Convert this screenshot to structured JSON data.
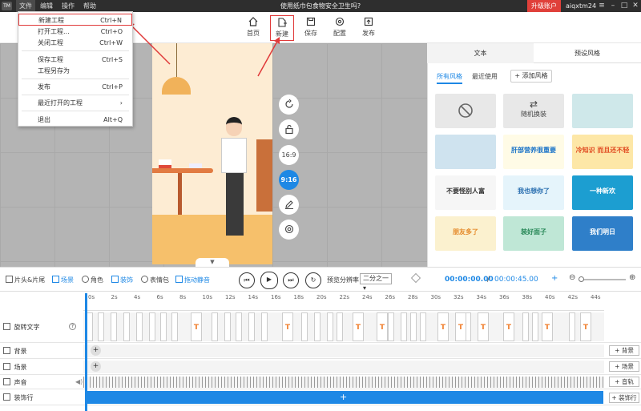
{
  "titlebar": {
    "logo": "TM",
    "menus": [
      "文件",
      "编辑",
      "操作",
      "帮助"
    ],
    "title": "使用纸巾包食物安全卫生吗?",
    "upgrade": "升级账户",
    "user": "aiqxtm24",
    "controls": {
      "menu": "≡",
      "minimize": "–",
      "maximize": "□",
      "close": "✕"
    }
  },
  "toolbar": {
    "home": "首页",
    "new": "新建",
    "save": "保存",
    "config": "配置",
    "publish": "发布"
  },
  "file_menu": {
    "items": [
      {
        "label": "新建工程",
        "shortcut": "Ctrl+N"
      },
      {
        "label": "打开工程...",
        "shortcut": "Ctrl+O"
      },
      {
        "label": "关闭工程",
        "shortcut": "Ctrl+W"
      },
      {
        "label": "保存工程",
        "shortcut": "Ctrl+S"
      },
      {
        "label": "工程另存为",
        "shortcut": ""
      },
      {
        "label": "发布",
        "shortcut": "Ctrl+P"
      },
      {
        "label": "最近打开的工程",
        "shortcut": "›"
      },
      {
        "label": "退出",
        "shortcut": "Alt+Q"
      }
    ]
  },
  "canvas": {
    "ratio_169": "16:9",
    "ratio_916": "9:16",
    "collapse": "▼"
  },
  "right_panel": {
    "tab_text": "文本",
    "tab_preset": "预设风格",
    "filter_all": "所有风格",
    "filter_recent": "最近使用",
    "add_style": "+ 添加风格",
    "random": "随机换装",
    "cards": [
      {
        "text": "",
        "bg": "#e8e8e8",
        "color": "#666"
      },
      {
        "text": "随机换装",
        "bg": "#e8e8e8",
        "color": "#444"
      },
      {
        "text": "",
        "bg": "#cfe8ea",
        "color": "#333"
      },
      {
        "text": "",
        "bg": "#cfe3ef",
        "color": "#333"
      },
      {
        "text": "肝部营养很重要",
        "bg": "#fffbe6",
        "color": "#1a73c8"
      },
      {
        "text": "冷知识 而且还不轻",
        "bg": "#fde7a7",
        "color": "#e04a20"
      },
      {
        "text": "不要怪别人富",
        "bg": "#f6f6f6",
        "color": "#333"
      },
      {
        "text": "我也想你了",
        "bg": "#e5f4fb",
        "color": "#2a6fb0"
      },
      {
        "text": "一种新欢",
        "bg": "#1c9ed1",
        "color": "#fff"
      },
      {
        "text": "朋友多了",
        "bg": "#fbf1cf",
        "color": "#e58a2a"
      },
      {
        "text": "装好面子",
        "bg": "#bfe7d6",
        "color": "#2b8a5a"
      },
      {
        "text": "我们明日",
        "bg": "#2f7fc9",
        "color": "#fff"
      }
    ]
  },
  "timeline": {
    "options": [
      "片头&片尾",
      "场景",
      "角色",
      "装饰",
      "表情包",
      "拖动静音"
    ],
    "preview_label": "预览分辨率",
    "preview_value": "二分之一",
    "time_current": "00:00:00.00",
    "time_sep": "/",
    "time_total": "00:00:45.00",
    "ticks": [
      "0s",
      "2s",
      "4s",
      "6s",
      "8s",
      "10s",
      "12s",
      "14s",
      "16s",
      "18s",
      "20s",
      "22s",
      "24s",
      "26s",
      "28s",
      "30s",
      "32s",
      "34s",
      "36s",
      "38s",
      "40s",
      "42s",
      "44s"
    ],
    "tracks": [
      {
        "label": "旋转文字",
        "help": "?"
      },
      {
        "label": "背景",
        "add": "+ 背景"
      },
      {
        "label": "场景",
        "add": "+ 场景"
      },
      {
        "label": "声音",
        "add": "+ 音轨"
      },
      {
        "label": "装饰行",
        "add": "+ 装饰行"
      }
    ],
    "t_glyph": "T",
    "plus": "+"
  },
  "colors": {
    "accent": "#1e88e5",
    "highlight": "#e03a3a",
    "upgrade": "#e0403a"
  }
}
